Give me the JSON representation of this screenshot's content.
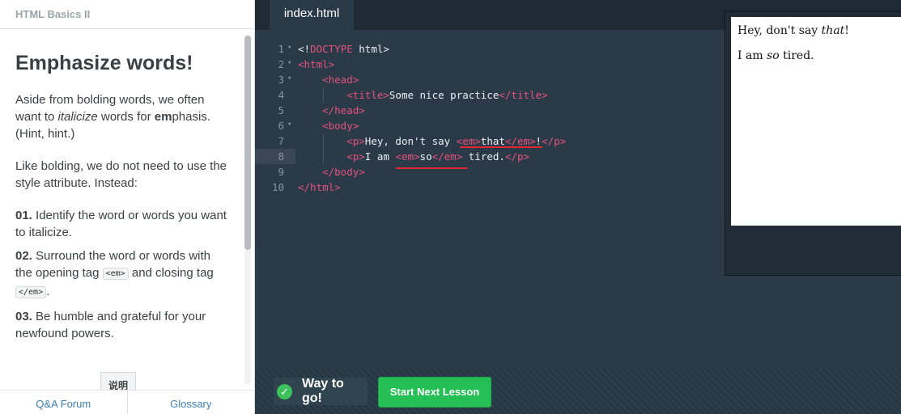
{
  "course": {
    "title": "HTML Basics II"
  },
  "lesson": {
    "heading": "Emphasize words!",
    "intro": {
      "a": "Aside from bolding words, we often want to ",
      "b": "italicize",
      "c": " words for ",
      "d": "em",
      "e": "phasis. (Hint, hint.)"
    },
    "para2": "Like bolding, we do not need to use the style attribute. Instead:",
    "steps": [
      {
        "num": "01.",
        "text": " Identify the word or words you want to italicize."
      },
      {
        "num": "02.",
        "text_a": " Surround the word or words with the opening tag ",
        "code1": "<em>",
        "text_b": " and closing tag ",
        "code2": "</em>",
        "text_c": "."
      },
      {
        "num": "03.",
        "text": " Be humble and grateful for your newfound powers."
      }
    ],
    "tip_tab": "说明"
  },
  "footer": {
    "qa": "Q&A Forum",
    "glossary": "Glossary"
  },
  "editor": {
    "tab": "index.html",
    "lines": [
      {
        "n": "1",
        "fold": "▾",
        "p": [
          "<!",
          "DOCTYPE",
          " html>"
        ]
      },
      {
        "n": "2",
        "fold": "▾",
        "p": [
          "<html>"
        ]
      },
      {
        "n": "3",
        "fold": "▾",
        "p": [
          "    ",
          "<head>"
        ]
      },
      {
        "n": "4",
        "fold": "",
        "p": [
          "        ",
          "<title>",
          "Some nice practice",
          "</title>"
        ]
      },
      {
        "n": "5",
        "fold": "",
        "p": [
          "    ",
          "</head>"
        ]
      },
      {
        "n": "6",
        "fold": "▾",
        "p": [
          "    ",
          "<body>"
        ]
      },
      {
        "n": "7",
        "fold": "",
        "p": [
          "        ",
          "<p>",
          "Hey, don't say ",
          "<em>",
          "that",
          "</em>",
          "!",
          "</p>"
        ]
      },
      {
        "n": "8",
        "fold": "",
        "p": [
          "        ",
          "<p>",
          "I am ",
          "<em>",
          "so",
          "</em>",
          " tired.",
          "</p>"
        ]
      },
      {
        "n": "9",
        "fold": "",
        "p": [
          "    ",
          "</body>"
        ]
      },
      {
        "n": "10",
        "fold": "",
        "p": [
          "</html>"
        ]
      }
    ]
  },
  "preview": {
    "line1": {
      "a": "Hey, don't say ",
      "em": "that",
      "b": "!"
    },
    "line2": {
      "a": "I am ",
      "em": "so",
      "b": " tired."
    }
  },
  "actions": {
    "success": "Way to go!",
    "next": "Start Next Lesson"
  },
  "colors": {
    "accent_green": "#25c055",
    "tag_pink": "#e4527a",
    "editor_bg": "#2b3a48",
    "underline_red": "#e6262f"
  },
  "icons": {
    "check": "checkmark-icon",
    "fold": "fold-arrow-icon"
  }
}
